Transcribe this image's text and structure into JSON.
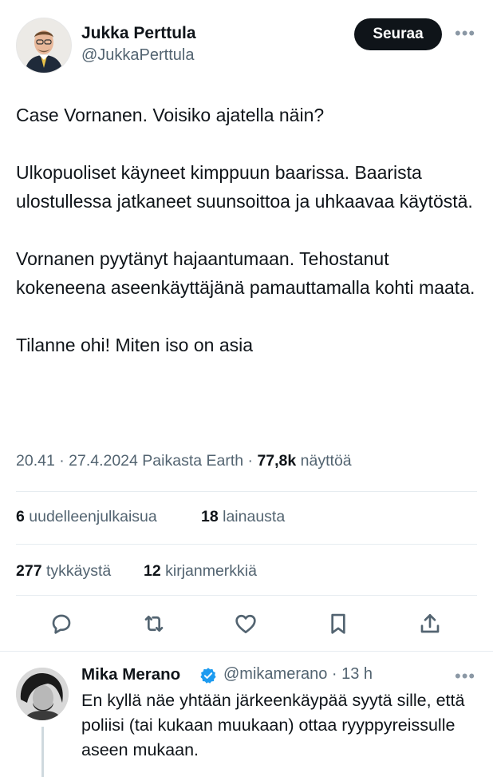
{
  "tweet": {
    "author_name": "Jukka Perttula",
    "author_handle": "@JukkaPerttula",
    "follow_label": "Seuraa",
    "more_label": "•••",
    "text": "Case Vornanen. Voisiko ajatella näin?\n\nUlkopuoliset käyneet kimppuun baarissa. Baarista ulostullessa jatkaneet suunsoittoa ja uhkaavaa käytöstä.\n\nVornanen pyytänyt hajaantumaan. Tehostanut kokeneena aseenkäyttäjänä pamauttamalla kohti maata.\n\nTilanne ohi! Miten iso on asia",
    "meta_time": "20.41 · 27.4.2024 Paikasta Earth · ",
    "views_count": "77,8k",
    "views_label": " näyttöä"
  },
  "stats": {
    "reposts_count": "6",
    "reposts_label": " uudelleenjulkaisua",
    "quotes_count": "18",
    "quotes_label": " lainausta",
    "likes_count": "277",
    "likes_label": " tykkäystä",
    "bookmarks_count": "12",
    "bookmarks_label": " kirjanmerkkiä"
  },
  "actions": [
    "reply-icon",
    "repost-icon",
    "like-icon",
    "bookmark-icon",
    "share-icon"
  ],
  "reply": {
    "author_name": "Mika Merano",
    "author_handle": "@mikamerano · 13 h",
    "more_label": "•••",
    "text": "En kyllä näe yhtään järkeenkäypää syytä sille, että poliisi (tai kukaan muukaan) ottaa ryyppyreissulle aseen mukaan."
  },
  "colors": {
    "verified": "#1d9bf0",
    "secondary_text": "#536471",
    "primary": "#0f1419"
  }
}
